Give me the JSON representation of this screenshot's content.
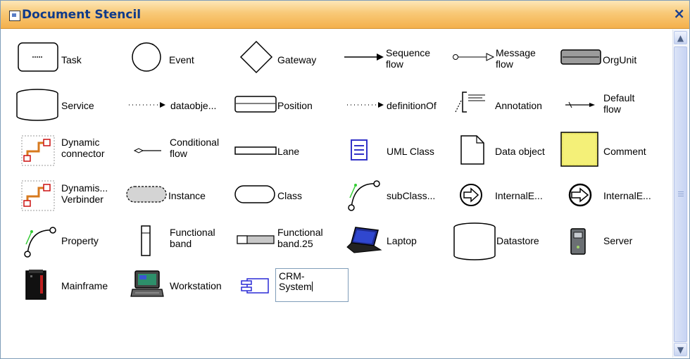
{
  "window": {
    "title": "Document Stencil",
    "close_glyph": "×"
  },
  "scrollbar": {
    "up_glyph": "▲",
    "down_glyph": "▼"
  },
  "shapes": {
    "task": {
      "label": "Task",
      "inner": "∞∞"
    },
    "event": {
      "label": "Event"
    },
    "gateway": {
      "label": "Gateway"
    },
    "sequence_flow": {
      "label1": "Sequence",
      "label2": "flow"
    },
    "message_flow": {
      "label1": "Message",
      "label2": "flow"
    },
    "orgunit": {
      "label": "OrgUnit"
    },
    "service": {
      "label": "Service"
    },
    "dataobject": {
      "label": "dataobje..."
    },
    "position": {
      "label": "Position"
    },
    "definitionof": {
      "label": "definitionOf"
    },
    "annotation": {
      "label": "Annotation"
    },
    "default_flow": {
      "label1": "Default",
      "label2": "flow"
    },
    "dynamic_connector": {
      "label1": "Dynamic",
      "label2": "connector"
    },
    "conditional_flow": {
      "label1": "Conditional",
      "label2": "flow"
    },
    "lane": {
      "label": "Lane"
    },
    "uml_class": {
      "label": "UML Class"
    },
    "data_object": {
      "label": "Data object"
    },
    "comment": {
      "label": "Comment"
    },
    "dynamis_verbinder": {
      "label1": "Dynamis...",
      "label2": "Verbinder"
    },
    "instance": {
      "label": "Instance"
    },
    "class": {
      "label": "Class"
    },
    "subclass": {
      "label": "subClass..."
    },
    "internal_e1": {
      "label": "InternalE..."
    },
    "internal_e2": {
      "label": "InternalE..."
    },
    "property": {
      "label": "Property"
    },
    "functional_band": {
      "label1": "Functional",
      "label2": "band"
    },
    "functional_band_25": {
      "label1": "Functional",
      "label2": "band.25"
    },
    "laptop": {
      "label": "Laptop"
    },
    "datastore": {
      "label": "Datastore"
    },
    "server": {
      "label": "Server"
    },
    "mainframe": {
      "label": "Mainframe"
    },
    "workstation": {
      "label": "Workstation"
    },
    "crm_system": {
      "value_line1": "CRM-",
      "value_line2": "System"
    }
  }
}
